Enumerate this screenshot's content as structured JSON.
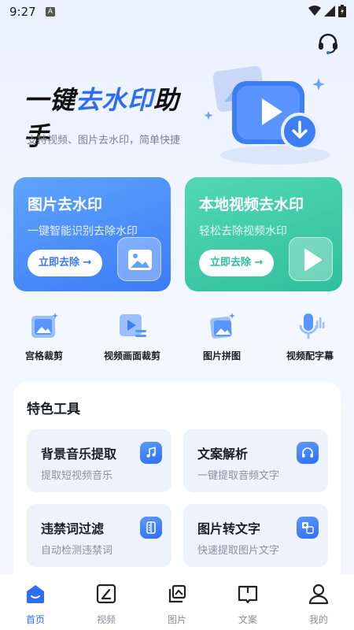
{
  "status_bar": {
    "time": "9:27",
    "badge": "A"
  },
  "hero": {
    "title_part1": "一键",
    "title_part2": "去水印",
    "title_part3": "助手",
    "subtitle": "支持视频、图片去水印，简单快捷"
  },
  "cards": [
    {
      "title": "图片去水印",
      "desc": "一键智能识别去除水印",
      "button": "立即去除 →"
    },
    {
      "title": "本地视频去水印",
      "desc": "轻松去除视频水印",
      "button": "立即去除 →"
    }
  ],
  "tools": [
    {
      "label": "宫格裁剪"
    },
    {
      "label": "视频画面裁剪"
    },
    {
      "label": "图片拼图"
    },
    {
      "label": "视频配字幕"
    }
  ],
  "features": {
    "heading": "特色工具",
    "items": [
      {
        "title": "背景音乐提取",
        "desc": "提取短视频音乐"
      },
      {
        "title": "文案解析",
        "desc": "一键提取音频文字"
      },
      {
        "title": "违禁词过滤",
        "desc": "自动检测违禁词"
      },
      {
        "title": "图片转文字",
        "desc": "快速提取图片文字"
      }
    ]
  },
  "nav": [
    {
      "label": "首页"
    },
    {
      "label": "视频"
    },
    {
      "label": "图片"
    },
    {
      "label": "文案"
    },
    {
      "label": "我的"
    }
  ],
  "colors": {
    "brand": "#2f6df6",
    "card_blue": "#3b7cf5",
    "card_green": "#2fbf9c",
    "inactive": "#8a8f9b"
  }
}
